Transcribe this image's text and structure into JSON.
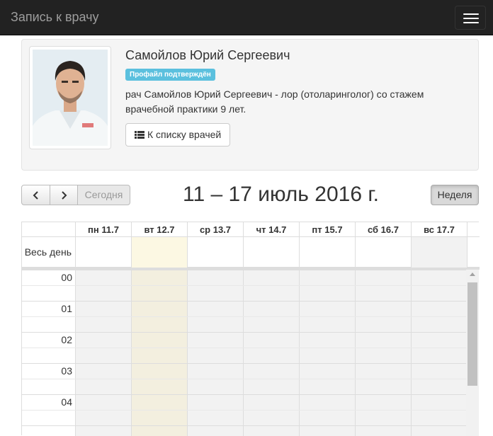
{
  "navbar": {
    "brand": "Запись к врачу",
    "menu_icon": "hamburger-icon"
  },
  "doctor": {
    "name": "Самойлов Юрий Сергеевич",
    "badge": "Профайл подтверждён",
    "description": "рач Самойлов Юрий Сергеевич - лор (отоларинголог) со стажем врачебной практики 9 лет.",
    "back_button": "К списку врачей",
    "back_icon": "list-icon"
  },
  "calendar": {
    "prev_icon": "chevron-left-icon",
    "next_icon": "chevron-right-icon",
    "today_label": "Сегодня",
    "title": "11 – 17 июль 2016 г.",
    "view_label": "Неделя",
    "allday_label": "Весь день",
    "days": [
      "пн 11.7",
      "вт 12.7",
      "ср 13.7",
      "чт 14.7",
      "пт 15.7",
      "сб 16.7",
      "вс 17.7"
    ],
    "hours": [
      "00",
      "01",
      "02",
      "03",
      "04"
    ]
  },
  "colors": {
    "navbar": "#222222",
    "badge": "#5bc0de",
    "today_highlight": "#fcf8e3"
  }
}
